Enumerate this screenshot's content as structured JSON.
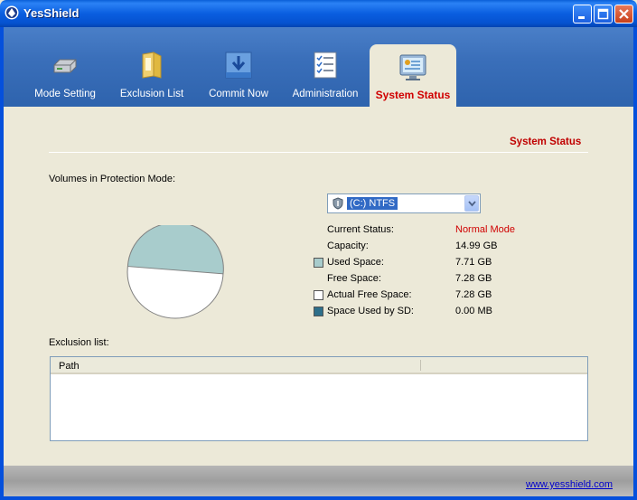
{
  "window": {
    "title": "YesShield"
  },
  "toolbar": {
    "items": [
      {
        "label": "Mode Setting",
        "icon": "disk-drive-icon"
      },
      {
        "label": "Exclusion List",
        "icon": "folder-icon"
      },
      {
        "label": "Commit Now",
        "icon": "commit-arrow-icon"
      },
      {
        "label": "Administration",
        "icon": "checklist-icon"
      },
      {
        "label": "System Status",
        "icon": "monitor-icon",
        "active": true
      }
    ]
  },
  "content": {
    "section_title": "System Status",
    "volumes_label": "Volumes in Protection Mode:",
    "volume_select": {
      "selected": "(C:) NTFS"
    },
    "info": [
      {
        "key": "Current Status:",
        "value": "Normal Mode",
        "swatch": null
      },
      {
        "key": "Capacity:",
        "value": "14.99 GB",
        "swatch": null
      },
      {
        "key": "Used Space:",
        "value": "7.71 GB",
        "swatch": "#a8cccc"
      },
      {
        "key": "Free Space:",
        "value": "7.28 GB",
        "swatch": null
      },
      {
        "key": "Actual Free Space:",
        "value": "7.28 GB",
        "swatch": "#ffffff"
      },
      {
        "key": "Space Used by SD:",
        "value": "0.00 MB",
        "swatch": "#2e6f8a"
      }
    ],
    "pie": {
      "used_fraction": 0.514,
      "used_color": "#a8cccc",
      "free_color": "#ffffff"
    },
    "exclusion_label": "Exclusion list:",
    "exclusion_table": {
      "columns": [
        "Path",
        ""
      ],
      "rows": []
    }
  },
  "statusbar": {
    "link": "www.yesshield.com"
  },
  "colors": {
    "accent_red": "#d00000",
    "toolbar_blue": "#3a6fba",
    "titlebar_blue": "#0a5ee0"
  }
}
